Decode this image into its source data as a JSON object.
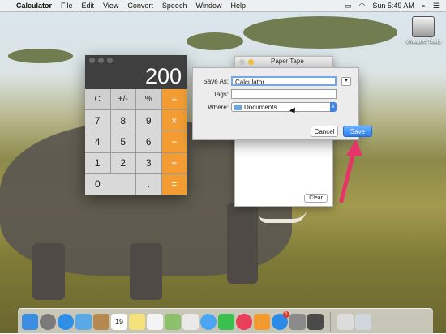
{
  "menubar": {
    "app_name": "Calculator",
    "items": [
      "File",
      "Edit",
      "View",
      "Convert",
      "Speech",
      "Window",
      "Help"
    ],
    "clock": "Sun 5:49 AM"
  },
  "desktop": {
    "vmware_label": "VMware Tools"
  },
  "calculator": {
    "display": "200",
    "keys": [
      "C",
      "+/-",
      "%",
      "÷",
      "7",
      "8",
      "9",
      "×",
      "4",
      "5",
      "6",
      "−",
      "1",
      "2",
      "3",
      "+",
      "0",
      ".",
      "="
    ]
  },
  "paper_tape": {
    "title": "Paper Tape",
    "clear_label": "Clear"
  },
  "save_sheet": {
    "save_as_label": "Save As:",
    "save_as_value": "Calculator",
    "tags_label": "Tags:",
    "tags_value": "",
    "where_label": "Where:",
    "where_value": "Documents",
    "cancel_label": "Cancel",
    "save_label": "Save"
  },
  "dock": {
    "icons": [
      "finder-icon",
      "launchpad-icon",
      "safari-icon",
      "mail-icon",
      "contacts-icon",
      "calendar-icon",
      "notes-icon",
      "reminders-icon",
      "maps-icon",
      "photos-icon",
      "messages-icon",
      "facetime-icon",
      "itunes-icon",
      "ibooks-icon",
      "app-store-icon",
      "system-preferences-icon",
      "calculator-icon",
      "documents-icon",
      "trash-icon"
    ],
    "calendar_day": "19",
    "app_store_badge": "1"
  },
  "colors": {
    "accent": "#2d7cf0",
    "calc_operator": "#f39c33",
    "annotation_arrow": "#e8326a"
  }
}
